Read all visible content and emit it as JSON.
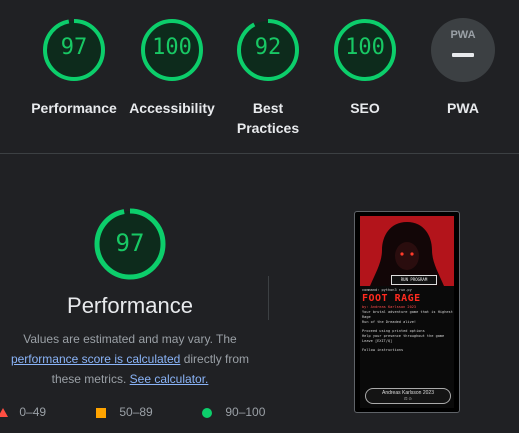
{
  "categories": [
    {
      "id": "performance",
      "score": "97",
      "label": "Performance",
      "fraction": 0.97
    },
    {
      "id": "accessibility",
      "score": "100",
      "label": "Accessibility",
      "fraction": 1.0
    },
    {
      "id": "best-practices",
      "score": "92",
      "label_lines": [
        "Best",
        "Practices"
      ],
      "fraction": 0.92
    },
    {
      "id": "seo",
      "score": "100",
      "label": "SEO",
      "fraction": 1.0
    }
  ],
  "pwa": {
    "badge_text": "PWA",
    "label": "PWA"
  },
  "detail": {
    "score": "97",
    "fraction": 0.97,
    "title": "Performance",
    "desc_prefix": "Values are estimated and may vary. The",
    "link1": "performance score is calculated",
    "desc_mid": "directly from",
    "desc_line3": "these metrics.",
    "link2": "See calculator."
  },
  "legend": [
    {
      "range": "0–49",
      "color": "#ff4e42",
      "shape": "triangle"
    },
    {
      "range": "50–89",
      "color": "#ffa400",
      "shape": "square"
    },
    {
      "range": "90–100",
      "color": "#0cce6b",
      "shape": "circle"
    }
  ],
  "colors": {
    "pass": "#0cce6b",
    "bg": "#202124",
    "text": "#e8eaed",
    "muted": "#9aa0a6",
    "link": "#8ab4f8"
  },
  "thumbnail": {
    "run_button": "RUN PROGRAM",
    "cmd_line": "command: python3 run.py",
    "game_title": "FOOT RAGE",
    "author_line": "by: Andreas Karlsson 2023",
    "intro1": "Your brutal adventure game that is Highest Rage",
    "intro2": "Run of the Dreaded alive!",
    "instr1": "Proceed using printed options",
    "instr2": "Help your presence throughout the game",
    "instr3": "Leave [EXIT/Q]",
    "prompt": "Follow instructions",
    "footer_name": "Andreas Karlsson 2023",
    "footer_icons": "⊡ ⊙"
  }
}
